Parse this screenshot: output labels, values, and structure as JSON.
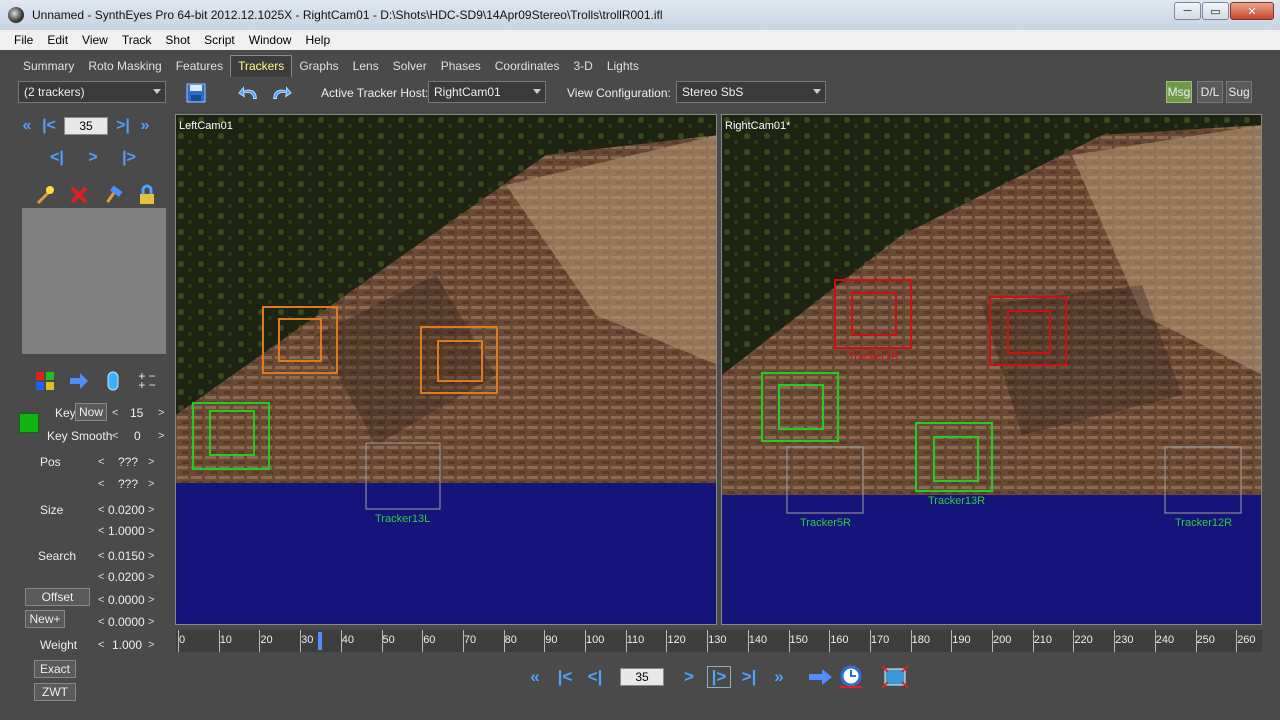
{
  "window": {
    "title": "Unnamed - SynthEyes Pro 64-bit 2012.12.1025X - RightCam01 - D:\\Shots\\HDC-SD9\\14Apr09Stereo\\Trolls\\trollR001.ifl",
    "min": "─",
    "max": "▭",
    "close": "✕"
  },
  "menu": [
    "File",
    "Edit",
    "View",
    "Track",
    "Shot",
    "Script",
    "Window",
    "Help"
  ],
  "tabs": [
    "Summary",
    "Roto Masking",
    "Features",
    "Trackers",
    "Graphs",
    "Lens",
    "Solver",
    "Phases",
    "Coordinates",
    "3-D",
    "Lights"
  ],
  "toolbar": {
    "tracker_select": "(2 trackers)",
    "active_host_label": "Active Tracker Host:",
    "active_host_value": "RightCam01",
    "view_config_label": "View Configuration:",
    "view_config_value": "Stereo SbS",
    "msg": "Msg",
    "dl": "D/L",
    "sug": "Sug"
  },
  "left": {
    "frame": "35",
    "key_label": "Key",
    "now_label": "Now",
    "key_value": "15",
    "key_smooth_label": "Key Smooth",
    "key_smooth_value": "0",
    "pos_label": "Pos",
    "pos_x": "???",
    "pos_y": "???",
    "size_label": "Size",
    "size_1": "0.0200",
    "size_2": "1.0000",
    "search_label": "Search",
    "search_1": "0.0150",
    "search_2": "0.0200",
    "offset_label": "Offset",
    "offset_1": "0.0000",
    "newplus_label": "New+",
    "offset_2": "0.0000",
    "weight_label": "Weight",
    "weight_value": "1.000",
    "exact_label": "Exact",
    "zwt_label": "ZWT",
    "plusminus": "+ −\n+ −",
    "lt": "<",
    "gt": ">"
  },
  "viewports": {
    "left": {
      "name": "LeftCam01",
      "labels": [
        "Tracker13L"
      ]
    },
    "right": {
      "name": "RightCam01*",
      "labels": [
        "Tracker7R",
        "Tracker5R",
        "Tracker13R",
        "Tracker12R"
      ]
    }
  },
  "timeline": {
    "ticks": [
      "0",
      "10",
      "20",
      "30",
      "40",
      "50",
      "60",
      "70",
      "80",
      "90",
      "100",
      "110",
      "120",
      "130",
      "140",
      "150",
      "160",
      "170",
      "180",
      "190",
      "200",
      "210",
      "220",
      "230",
      "240",
      "250",
      "260"
    ],
    "current": 35
  },
  "transport": {
    "frame": "35"
  },
  "colors": {
    "sky": "#14147a",
    "tracker_green": "#22cc22",
    "tracker_orange": "#e07a20",
    "tracker_red": "#d01010",
    "accent_blue": "#4da3ff"
  }
}
